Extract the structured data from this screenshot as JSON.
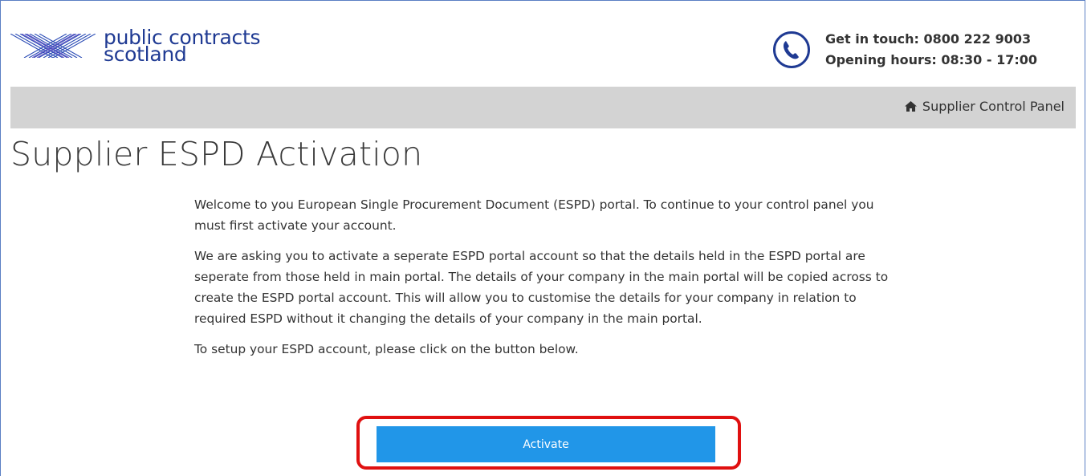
{
  "header": {
    "logo_line1": "public contracts",
    "logo_line2": "scotland",
    "contact_phone": "Get in touch: 0800 222 9003",
    "contact_hours": "Opening hours: 08:30 - 17:00"
  },
  "nav": {
    "control_panel_label": "Supplier Control Panel"
  },
  "page": {
    "title": "Supplier ESPD Activation",
    "paragraphs": [
      "Welcome to you European Single Procurement Document (ESPD) portal. To continue to your control panel you must first activate your account.",
      "We are asking you to activate a seperate ESPD portal account so that the details held in the ESPD portal are seperate from those held in main portal. The details of your company in the main portal will be copied across to create the ESPD portal account. This will allow you to customise the details for your company in relation to required ESPD without it changing the details of your company in the main portal.",
      "To setup your ESPD account, please click on the button below."
    ],
    "activate_label": "Activate"
  },
  "colors": {
    "brand_blue": "#1f3a93",
    "button_blue": "#2196e8",
    "highlight_red": "#e01010",
    "navbar_grey": "#d3d3d3"
  }
}
